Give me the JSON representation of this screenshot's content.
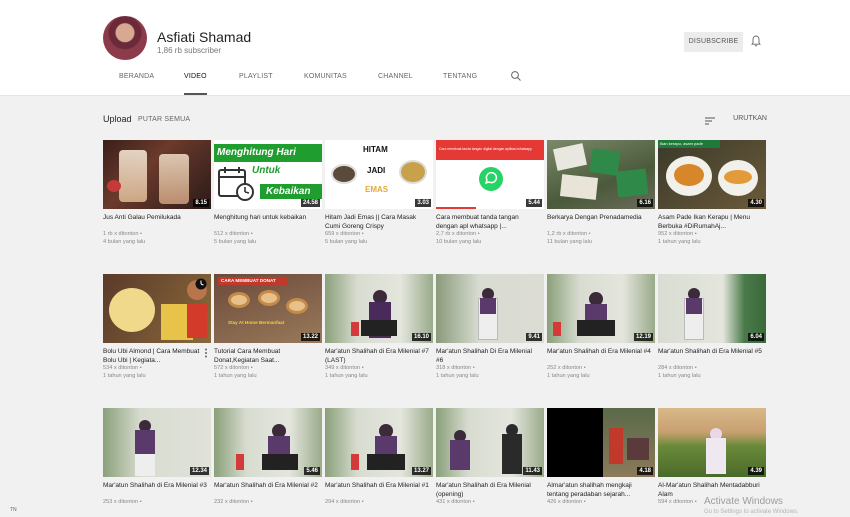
{
  "channel": {
    "name": "Asfiati Shamad",
    "subscribers": "1,86 rb subscriber",
    "unsubscribe_label": "DISUBSCRIBE"
  },
  "tabs": [
    {
      "label": "BERANDA"
    },
    {
      "label": "VIDEO"
    },
    {
      "label": "PLAYLIST"
    },
    {
      "label": "KOMUNITAS"
    },
    {
      "label": "CHANNEL"
    },
    {
      "label": "TENTANG"
    }
  ],
  "active_tab": "VIDEO",
  "section": {
    "title": "Upload",
    "play_all": "PUTAR SEMUA",
    "sort": "URUTKAN"
  },
  "videos": [
    {
      "title": "Jus Anti Galau Pemilukada",
      "views": "1 rb x ditonton •",
      "age": "4 bulan yang lalu",
      "duration": "8.15"
    },
    {
      "title": "Menghitung hari untuk kebaikan",
      "views": "512 x ditonton •",
      "age": "5 bulan yang lalu",
      "duration": "24.58"
    },
    {
      "title": "Hitam Jadi Emas || Cara Masak Cumi Goreng Crispy",
      "views": "659 x ditonton •",
      "age": "5 bulan yang lalu",
      "duration": "3.03"
    },
    {
      "title": "Cara membuat tanda tangan dengan apl whatsapp |...",
      "views": "2,7 rb x ditonton •",
      "age": "10 bulan yang lalu",
      "duration": "5.44"
    },
    {
      "title": "Berkarya Dengan Prenadamedia",
      "views": "1,2 rb x ditonton •",
      "age": "11 bulan yang lalu",
      "duration": "6.16"
    },
    {
      "title": "Asam Pade Ikan Kerapu | Menu Berbuka #DiRumahAj...",
      "views": "952 x ditonton •",
      "age": "1 tahun yang lalu",
      "duration": "4.30"
    },
    {
      "title": "Bolu Ubi Almond | Cara Membuat Bolu Ubi | Kegiata...",
      "views": "534 x ditonton •",
      "age": "1 tahun yang lalu",
      "duration": ""
    },
    {
      "title": "Tutorial Cara Membuat Donat,Kegiatan Saat...",
      "views": "572 x ditonton •",
      "age": "1 tahun yang lalu",
      "duration": "13.22"
    },
    {
      "title": "Mar'atun Shalihah di Era Milenial #7 (LAST)",
      "views": "349 x ditonton •",
      "age": "1 tahun yang lalu",
      "duration": "16.10"
    },
    {
      "title": "Mar'atun Shalihah Di Era Milenial #6",
      "views": "318 x ditonton •",
      "age": "1 tahun yang lalu",
      "duration": "9.41"
    },
    {
      "title": "Mar'atun Shalihah di Era Milenial #4",
      "views": "252 x ditonton •",
      "age": "1 tahun yang lalu",
      "duration": "12.19"
    },
    {
      "title": "Mar'atun Shalihah di Era Milenial #5",
      "views": "284 x ditonton •",
      "age": "1 tahun yang lalu",
      "duration": "6.04"
    },
    {
      "title": "Mar'atun Shalihah di Era Milenial #3",
      "views": "253 x ditonton •",
      "age": "",
      "duration": "12.34"
    },
    {
      "title": "Mar'atun Shalihah di Era Milenial #2",
      "views": "232 x ditonton •",
      "age": "",
      "duration": "5.46"
    },
    {
      "title": "Mar'atun Shalihah di Era Milenial #1",
      "views": "294 x ditonton •",
      "age": "",
      "duration": "13.27"
    },
    {
      "title": "Mar'atun Shalihah di Era Milenial (opening)",
      "views": "431 x ditonton •",
      "age": "",
      "duration": "11.43"
    },
    {
      "title": "Almar'atun shalihah mengkaji tentang peradaban sejarah...",
      "views": "426 x ditonton •",
      "age": "",
      "duration": "4.18"
    },
    {
      "title": "Al-Mar'atun Shalihah Mentadabburi Alam",
      "views": "594 x ditonton •",
      "age": "",
      "duration": "4.39"
    }
  ],
  "thumb_text": {
    "hari_line1": "Menghitung Hari",
    "hari_line2": "Untuk",
    "hari_line3": "Kebaikan",
    "hitam": "HITAM",
    "jadi": "JADI",
    "emas": "EMAS",
    "ttd": "Cara membuat tanda tangan digital dengan aplikasi whatsapp",
    "ikan": "Ikan kerapu, asam pade",
    "donat1": "CARA MEMBUAT DONAT",
    "donat2": "Stay At Home Bermanfaat"
  },
  "watermark": {
    "line1": "Activate Windows",
    "line2": "Go to Settings to activate Windows."
  },
  "corner_text": "TN",
  "colors": {
    "header_bg": "#ffffff",
    "page_bg": "#f1f1f1",
    "duration_bg": "#000000",
    "whatsapp_green": "#25d366"
  }
}
